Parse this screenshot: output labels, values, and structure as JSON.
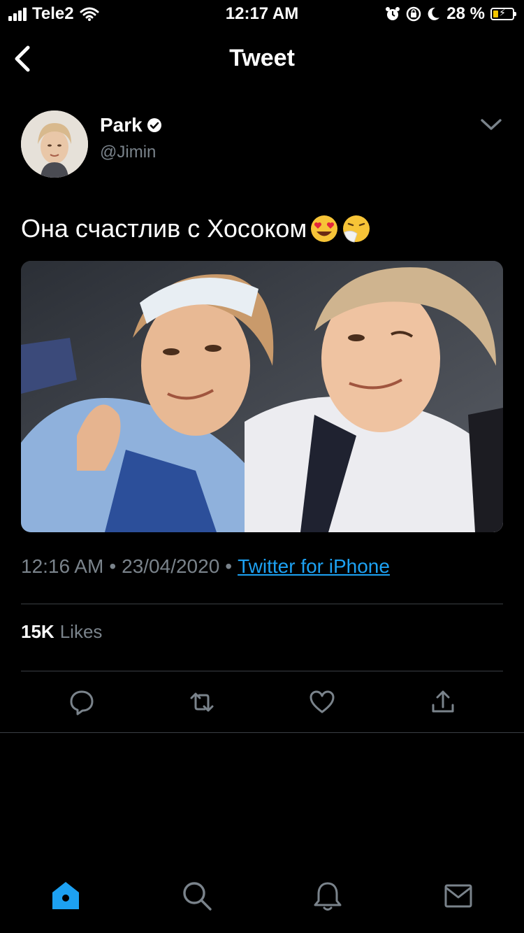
{
  "status_bar": {
    "carrier": "Tele2",
    "time": "12:17 AM",
    "battery_percent": "28 %",
    "battery_level": 0.28,
    "battery_color": "#f2c500"
  },
  "nav": {
    "title": "Tweet",
    "back_icon": "chevron-left-icon"
  },
  "tweet": {
    "author_name": "Park",
    "author_handle": "@Jimin",
    "verified": true,
    "text": "Она счастлив с Хосоком",
    "emojis": [
      "heart-eyes-emoji",
      "sneezing-face-emoji"
    ],
    "time": "12:16 AM",
    "date": "23/04/2020",
    "source": "Twitter for iPhone",
    "likes_count": "15K",
    "likes_label": "Likes"
  },
  "actions": [
    "reply-icon",
    "retweet-icon",
    "like-icon",
    "share-icon"
  ],
  "tabbar": [
    "home-icon",
    "search-icon",
    "notifications-icon",
    "messages-icon"
  ],
  "colors": {
    "background": "#000000",
    "accent": "#1da1f2",
    "muted_text": "#7a838b",
    "divider": "#3a3f44"
  }
}
